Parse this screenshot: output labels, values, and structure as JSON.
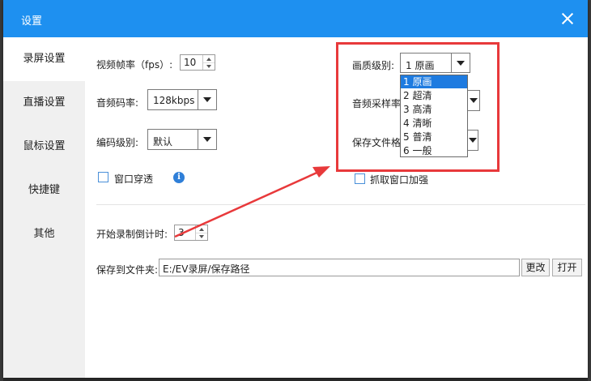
{
  "window": {
    "title": "设置"
  },
  "sidebar": {
    "items": [
      {
        "label": "录屏设置",
        "active": true
      },
      {
        "label": "直播设置",
        "active": false
      },
      {
        "label": "鼠标设置",
        "active": false
      },
      {
        "label": "快捷键",
        "active": false
      },
      {
        "label": "其他",
        "active": false
      }
    ]
  },
  "video": {
    "fps_label": "视频帧率（fps）:",
    "fps_value": "10",
    "bitrate_label": "音频码率:",
    "bitrate_value": "128kbps",
    "encode_label": "编码级别:",
    "encode_value": "默认"
  },
  "quality": {
    "label": "画质级别:",
    "value": "1 原画",
    "options": [
      "1 原画",
      "2 超清",
      "3 高清",
      "4 清晰",
      "5 普清",
      "6 一般"
    ],
    "selected_index": 0
  },
  "audio_sample": {
    "label": "音频采样率"
  },
  "save_format": {
    "label": "保存文件格"
  },
  "options": {
    "window_through_label": "窗口穿透",
    "window_through_checked": false,
    "capture_boost_label": "抓取窗口加强",
    "capture_boost_checked": false
  },
  "countdown": {
    "label": "开始录制倒计时:",
    "value": "3"
  },
  "save_path": {
    "label": "保存到文件夹:",
    "value": "E:/EV录屏/保存路径",
    "change_label": "更改",
    "open_label": "打开"
  },
  "colors": {
    "titlebar": "#1e90f0",
    "selection": "#1e7be0",
    "annotation": "#e8393b"
  }
}
